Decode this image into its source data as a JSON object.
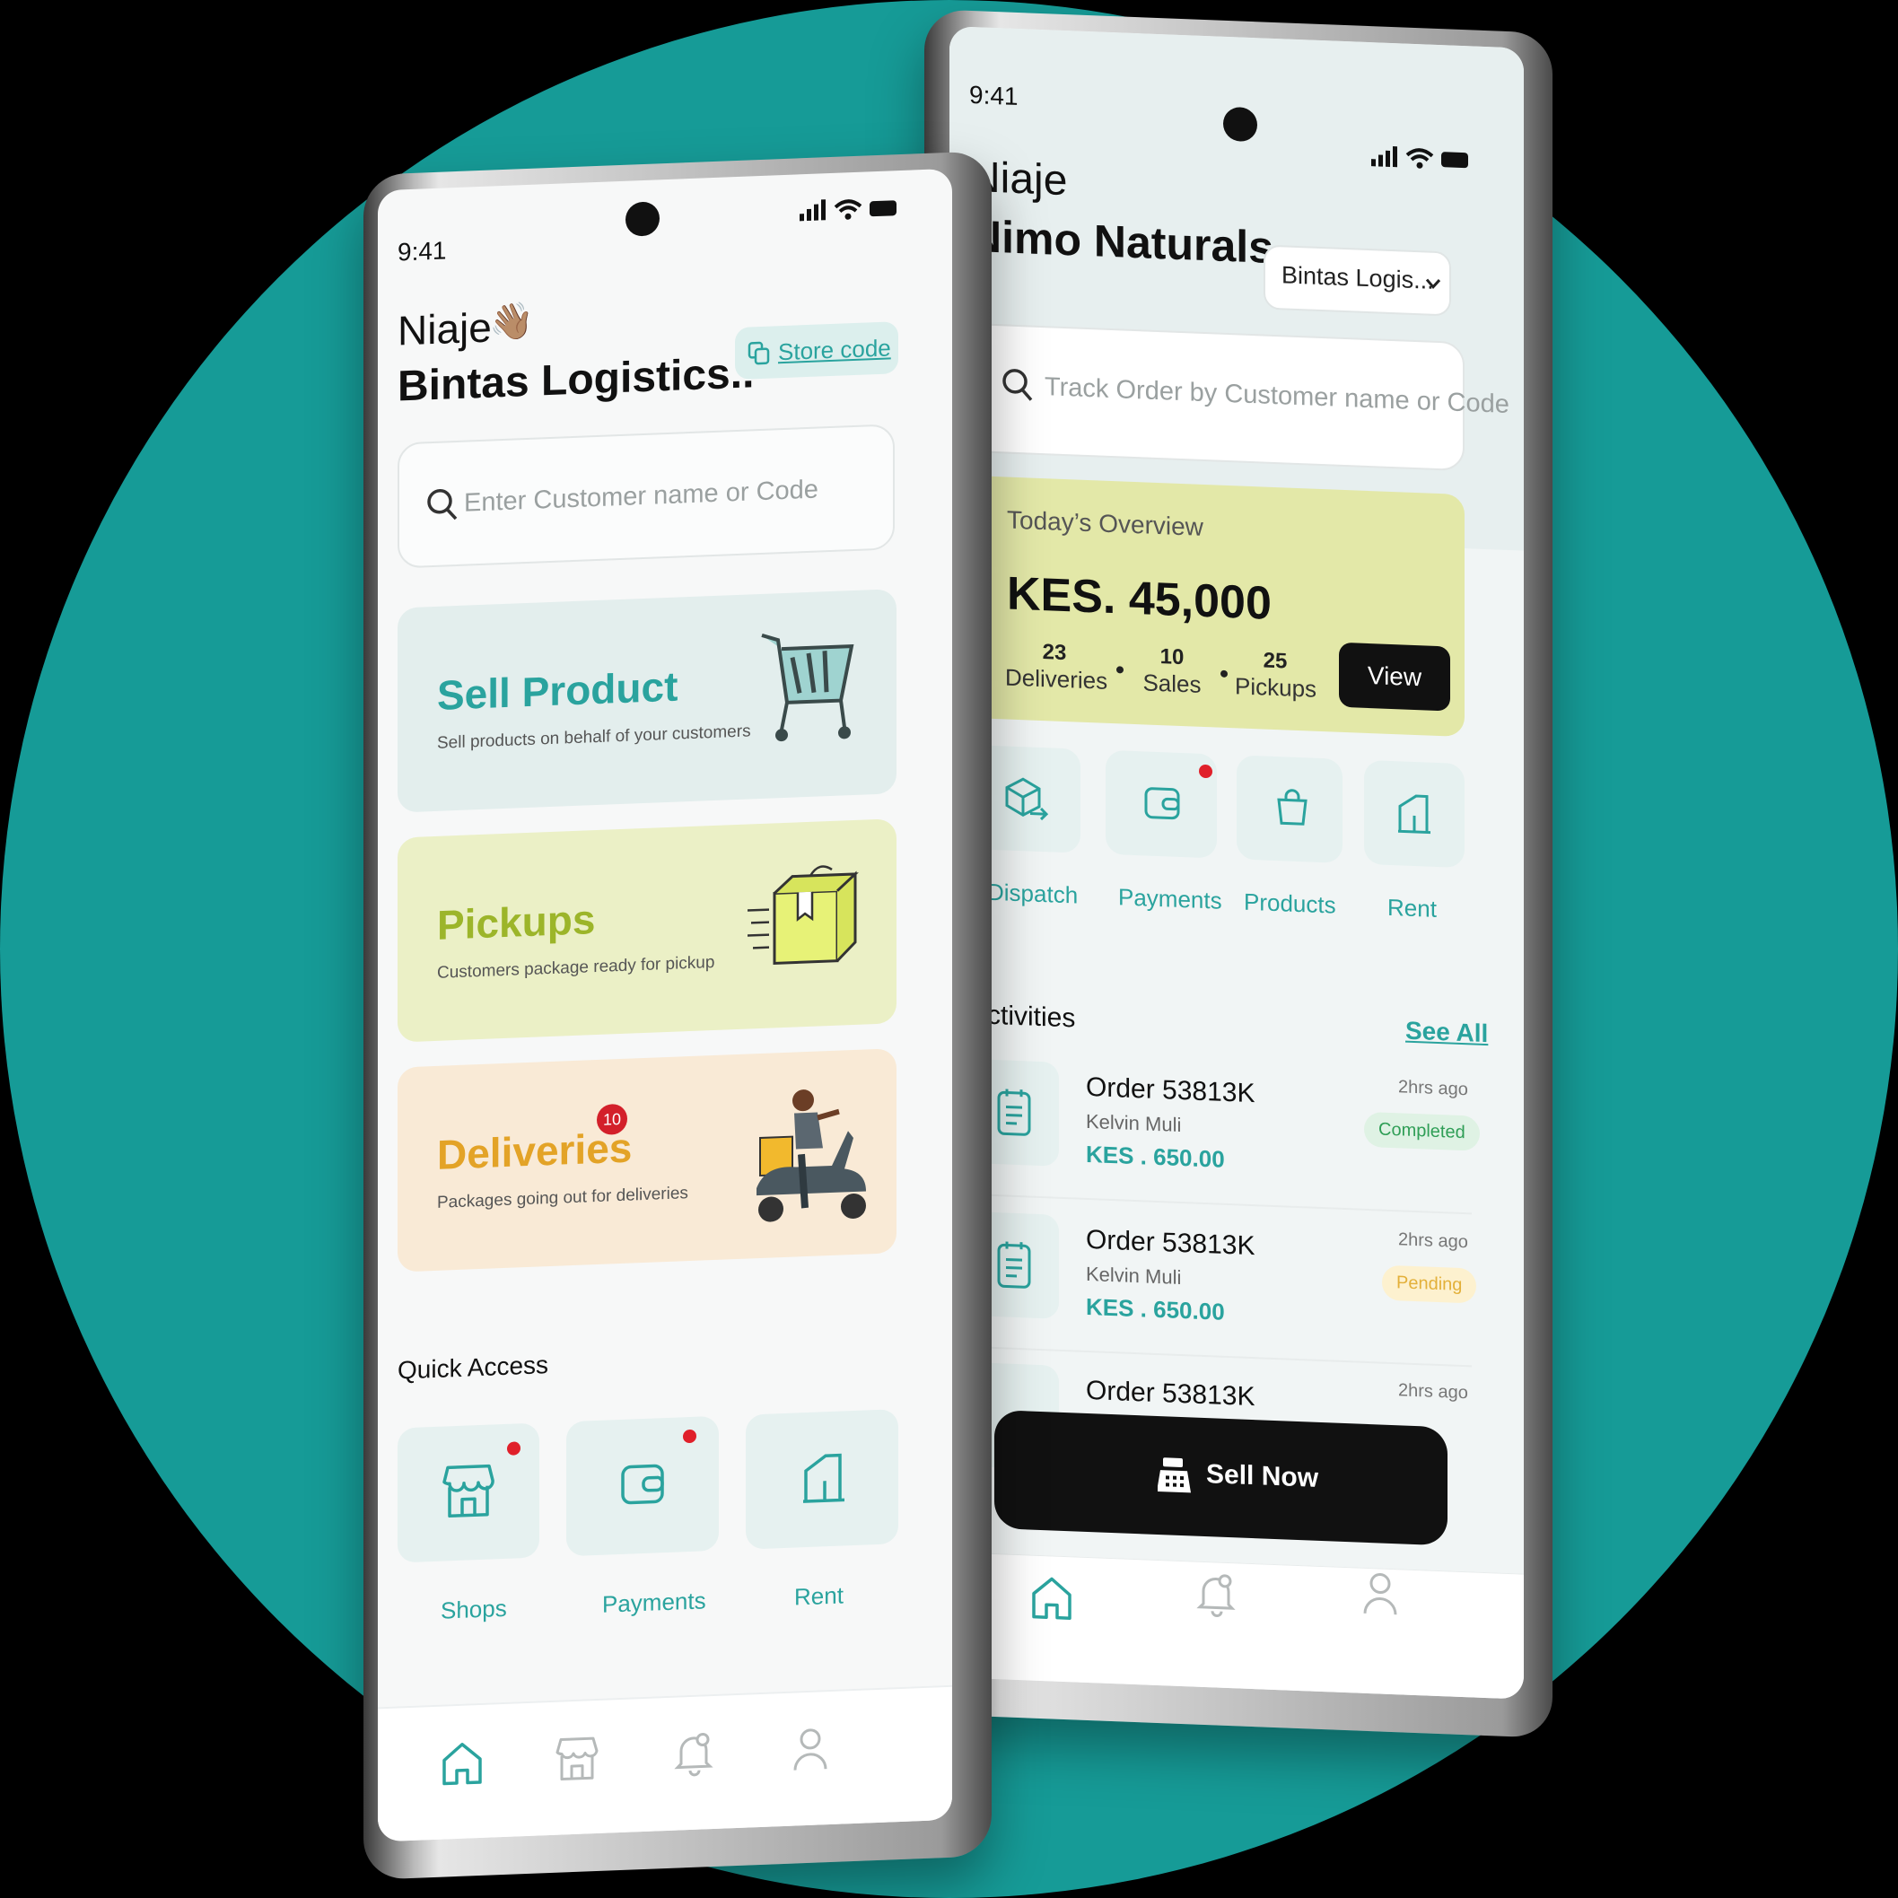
{
  "colors": {
    "teal": "#169b97",
    "accent_teal": "#2aa39e",
    "lime": "#9cb52a",
    "orange": "#e3a327",
    "black": "#111111",
    "red_badge": "#d3202a"
  },
  "left_phone": {
    "status_time": "9:41",
    "greeting": "Niaje",
    "greeting_emoji": "👋🏽",
    "store_name": "Bintas Logistics..",
    "store_code_label": "Store code",
    "search_placeholder": "Enter Customer name or Code",
    "cards": [
      {
        "title": "Sell Product",
        "subtitle": "Sell products on behalf of your customers",
        "icon": "shopping-cart-icon"
      },
      {
        "title": "Pickups",
        "subtitle": "Customers package ready for pickup",
        "icon": "package-box-icon"
      },
      {
        "title": "Deliveries",
        "subtitle": "Packages going out for deliveries",
        "badge": "10",
        "icon": "delivery-scooter-icon"
      }
    ],
    "quick_access_title": "Quick Access",
    "quick_access": [
      {
        "label": "Shops",
        "icon": "shop-icon",
        "notification": true
      },
      {
        "label": "Payments",
        "icon": "wallet-icon",
        "notification": true
      },
      {
        "label": "Rent",
        "icon": "door-icon",
        "notification": false
      }
    ],
    "nav": [
      "home-icon",
      "shop-icon",
      "bell-icon",
      "user-icon"
    ]
  },
  "right_phone": {
    "status_time": "9:41",
    "greeting": "Niaje",
    "store_name": "Nimo Naturals,",
    "store_selector": "Bintas Logis...",
    "search_placeholder": "Track Order by Customer name or Code",
    "overview": {
      "title": "Today’s Overview",
      "amount": "KES. 45,000",
      "stats": [
        {
          "value": "23",
          "label": "Deliveries"
        },
        {
          "value": "10",
          "label": "Sales"
        },
        {
          "value": "25",
          "label": "Pickups"
        }
      ],
      "view_label": "View"
    },
    "shortcuts": [
      {
        "label": "Dispatch",
        "icon": "dispatch-box-icon",
        "notification": false
      },
      {
        "label": "Payments",
        "icon": "wallet-icon",
        "notification": true
      },
      {
        "label": "Products",
        "icon": "shopping-bag-icon",
        "notification": false
      },
      {
        "label": "Rent",
        "icon": "door-icon",
        "notification": false
      }
    ],
    "activities_title": "Activities",
    "see_all": "See All",
    "activities": [
      {
        "order": "Order 53813K",
        "customer": "Kelvin Muli",
        "amount": "KES . 650.00",
        "time": "2hrs ago",
        "status": "Completed",
        "status_color": "#2f9e56",
        "status_bg": "#dff2e4"
      },
      {
        "order": "Order 53813K",
        "customer": "Kelvin Muli",
        "amount": "KES . 650.00",
        "time": "2hrs ago",
        "status": "Pending",
        "status_color": "#e3b03a",
        "status_bg": "#fdf1cf"
      },
      {
        "order": "Order 53813K",
        "time": "2hrs ago"
      }
    ],
    "sell_now_label": "Sell Now",
    "nav": [
      "home-icon",
      "bell-icon",
      "user-icon"
    ]
  }
}
